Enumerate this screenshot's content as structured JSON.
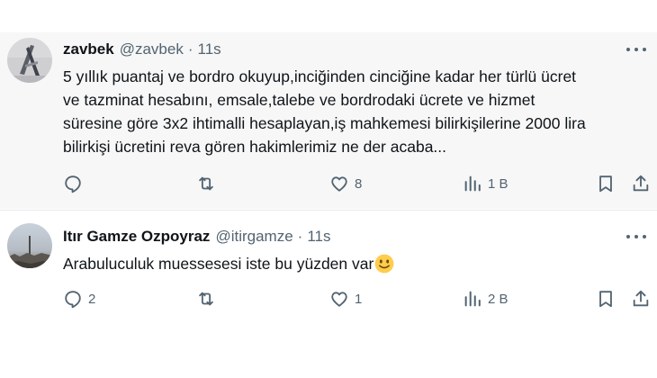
{
  "tweets": [
    {
      "name": "zavbek",
      "handle": "@zavbek",
      "separator": "·",
      "time": "11s",
      "text_lines": [
        "5 yıllık puantaj ve bordro okuyup,inciğinden cinciğine kadar her türlü ücret",
        "ve tazminat hesabını, emsale,talebe ve bordrodaki ücrete ve hizmet",
        "süresine göre 3x2 ihtimalli hesaplayan,iş mahkemesi bilirkişilerine 2000 lira",
        "bilirkişi ücretini reva gören hakimlerimiz ne der acaba..."
      ],
      "replies": "",
      "retweets": "",
      "likes": "8",
      "views": "1 B"
    },
    {
      "name": "Itır Gamze Ozpoyraz",
      "handle": "@itirgamze",
      "separator": "·",
      "time": "11s",
      "text_lines": [
        "Arabuluculuk muessesesi iste bu yüzden var"
      ],
      "emoji": "slightly-smiling-face",
      "replies": "2",
      "retweets": "",
      "likes": "1",
      "views": "2 B"
    }
  ],
  "icons": {
    "reply": "reply-icon",
    "retweet": "retweet-icon",
    "like": "heart-icon",
    "views": "views-chart-icon",
    "bookmark": "bookmark-icon",
    "share": "share-icon",
    "more": "more-dots-icon"
  },
  "colors": {
    "text": "#0f1419",
    "secondary": "#536471",
    "highlight_bg": "#f7f7f7"
  }
}
